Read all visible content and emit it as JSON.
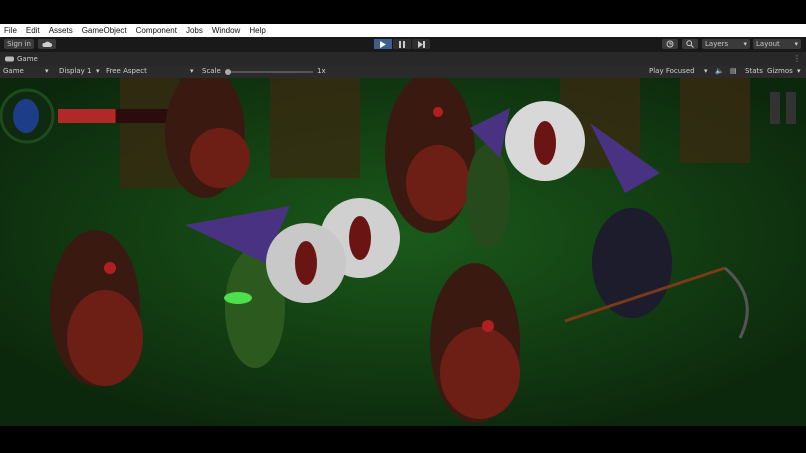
{
  "menu": [
    "File",
    "Edit",
    "Assets",
    "GameObject",
    "Component",
    "Jobs",
    "Window",
    "Help"
  ],
  "toolbar": {
    "signin": "Sign in",
    "layers": "Layers",
    "layout": "Layout"
  },
  "tab": {
    "title": "Game"
  },
  "options": {
    "view": "Game",
    "display": "Display 1",
    "aspect": "Free Aspect",
    "scale_label": "Scale",
    "scale_value": "1x",
    "play_mode": "Play Focused",
    "stats": "Stats",
    "gizmos": "Gizmos"
  },
  "hud": {
    "health_fraction": 0.48
  },
  "colors": {
    "viewport_bg": "#123912",
    "health": "#b02828",
    "play_active": "#3d5e8e"
  }
}
